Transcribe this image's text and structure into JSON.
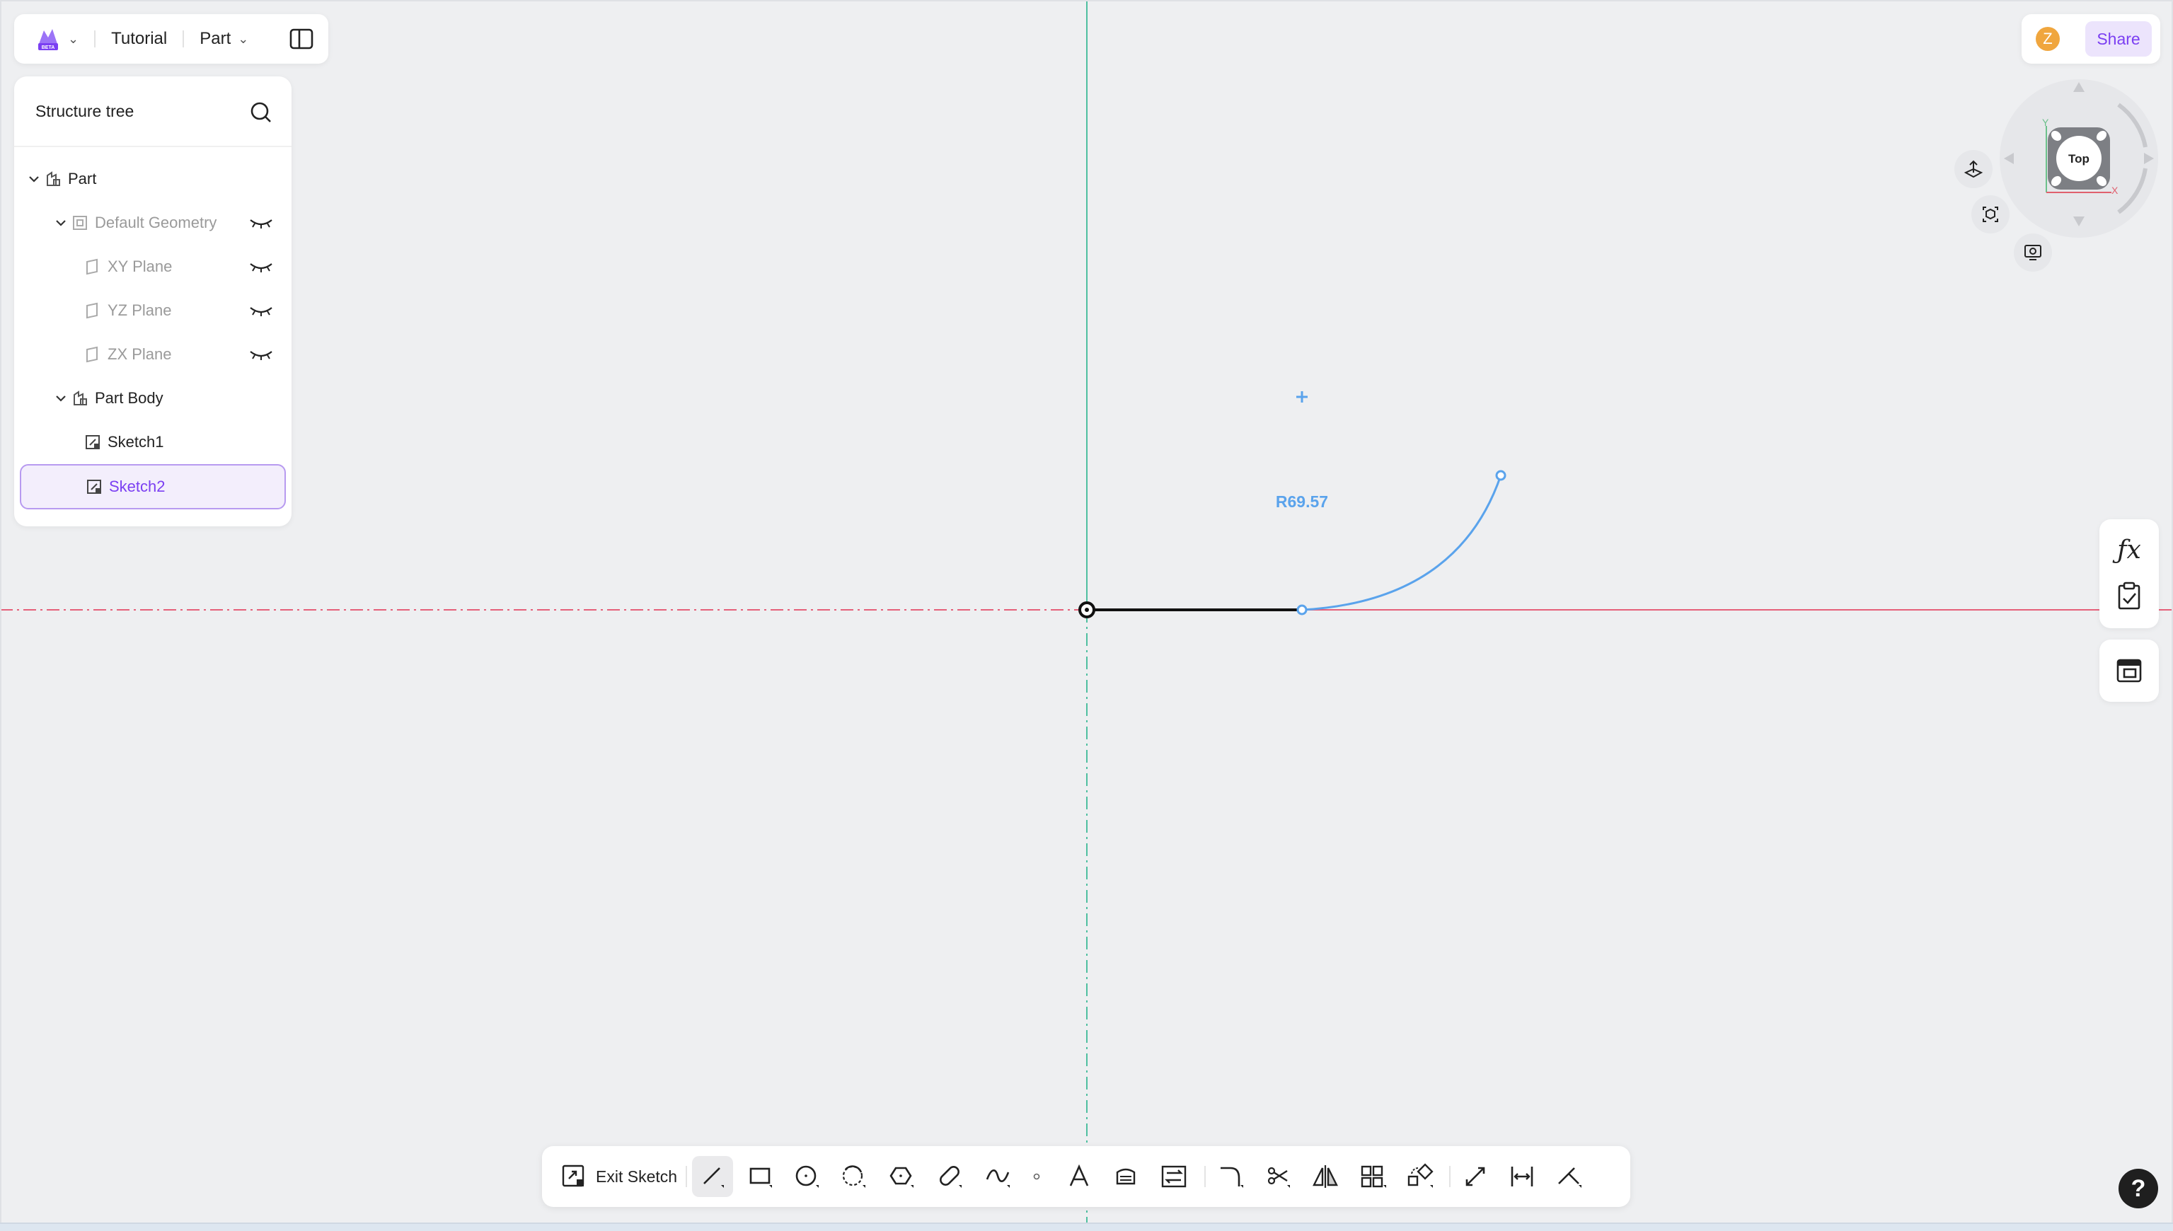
{
  "topbar": {
    "project_label": "Tutorial",
    "mode_label": "Part",
    "logo_icon": "app-logo-icon",
    "panel_icon": "split-panel-icon"
  },
  "structure_tree": {
    "title": "Structure tree",
    "items": [
      {
        "label": "Part",
        "icon": "part-icon"
      },
      {
        "label": "Default Geometry",
        "icon": "geometry-icon"
      },
      {
        "label": "XY Plane",
        "icon": "plane-icon"
      },
      {
        "label": "YZ Plane",
        "icon": "plane-icon"
      },
      {
        "label": "ZX Plane",
        "icon": "plane-icon"
      },
      {
        "label": "Part Body",
        "icon": "body-icon"
      },
      {
        "label": "Sketch1",
        "icon": "sketch-icon"
      },
      {
        "label": "Sketch2",
        "icon": "sketch-icon",
        "selected": true
      }
    ]
  },
  "header_right": {
    "avatar_initial": "Z",
    "share_label": "Share"
  },
  "view_cube": {
    "face_label": "Top",
    "axis_y": "Y",
    "axis_x": "X"
  },
  "sketch": {
    "dimension_label": "R69.57"
  },
  "toolbar": {
    "exit_label": "Exit Sketch",
    "tools": [
      "line",
      "rectangle",
      "circle",
      "arc",
      "polygon",
      "slot",
      "spline",
      "point",
      "text",
      "offset",
      "convert",
      "fillet",
      "trim",
      "mirror",
      "linear-pattern",
      "transform",
      "dimension",
      "distance",
      "constraint"
    ]
  },
  "help_label": "?",
  "colors": {
    "accent": "#7b3ff2",
    "sketch_blue": "#5aa3ec",
    "axis_red": "#e5607a",
    "axis_green": "#4fbfa0"
  }
}
